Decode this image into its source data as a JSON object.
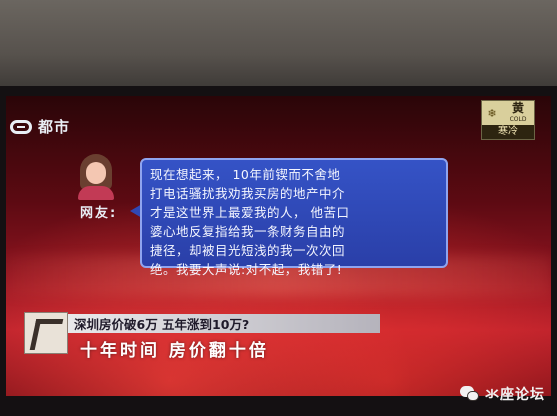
{
  "channel": {
    "name": "都市"
  },
  "weather": {
    "level": "黄",
    "english": "COLD",
    "label": "寒冷"
  },
  "speaker": {
    "label": "网友:"
  },
  "bubble": {
    "lines": [
      "现在想起来，  10年前锲而不舍地",
      "打电话骚扰我劝我买房的地产中介",
      "才是这世界上最爱我的人，  他苦口",
      "婆心地反复指给我一条财务自由的",
      "捷径，却被目光短浅的我一次次回",
      "绝。我要大声说:对不起，我错了!"
    ]
  },
  "ticker": {
    "headline": "深圳房价破6万 五年涨到10万?",
    "subheadline": "十年时间 房价翻十倍"
  },
  "watermark": {
    "text": "氺座论坛"
  }
}
